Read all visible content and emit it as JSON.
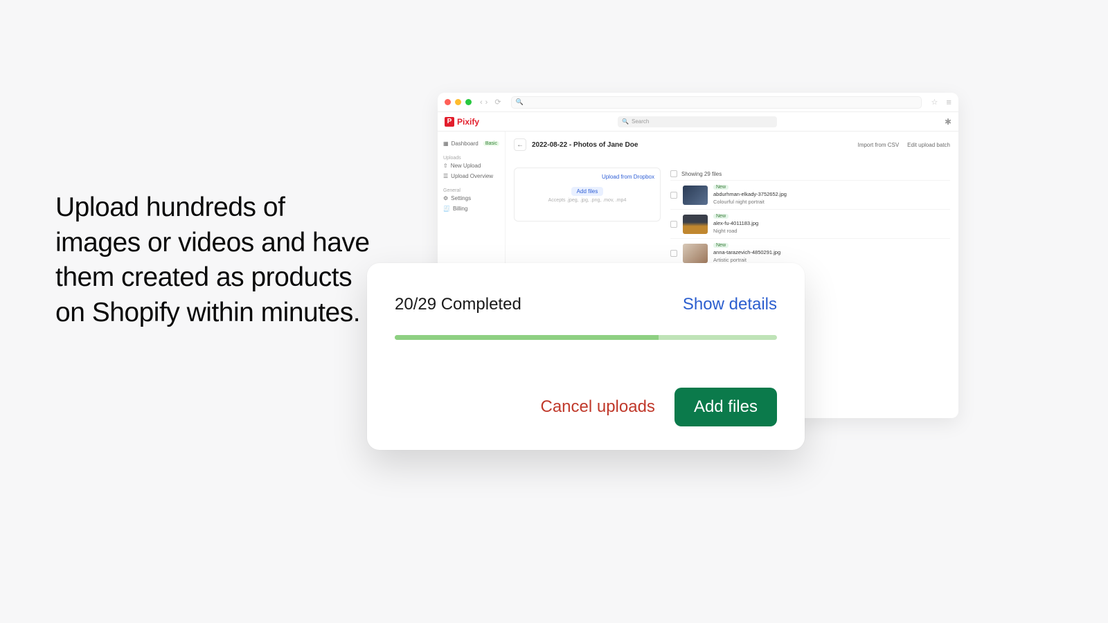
{
  "hero": {
    "title": "Upload hundreds of images or videos and have them created as products on Shopify within minutes."
  },
  "browser": {
    "urlbar_glyph": "🔍",
    "star_glyph": "☆",
    "menu_glyph": "≡"
  },
  "app": {
    "brand_letter": "P",
    "brand_name": "Pixify",
    "search_placeholder": "Search",
    "gear_glyph": "✱"
  },
  "sidebar": {
    "dashboard_label": "Dashboard",
    "dashboard_badge": "Basic",
    "section_uploads": "Uploads",
    "new_upload": "New Upload",
    "upload_overview": "Upload Overview",
    "section_general": "General",
    "settings": "Settings",
    "billing": "Billing"
  },
  "page": {
    "back_glyph": "←",
    "title": "2022-08-22 - Photos of Jane Doe",
    "import_csv": "Import from CSV",
    "edit_batch": "Edit upload batch"
  },
  "upload_card": {
    "dropbox_link": "Upload from Dropbox",
    "add_files": "Add files",
    "accepts": "Accepts .jpeg, .jpg, .png, .mov, .mp4"
  },
  "file_list": {
    "header": "Showing 29 files",
    "items": [
      {
        "badge": "New",
        "name": "abdurhman-elkady-3752652.jpg",
        "caption": "Colourful night portrait"
      },
      {
        "badge": "New",
        "name": "alex-fu-4011183.jpg",
        "caption": "Night road"
      },
      {
        "badge": "New",
        "name": "anna-tarazevich-4850291.jpg",
        "caption": "Artistic portrait"
      }
    ]
  },
  "modal": {
    "progress_label": "20/29 Completed",
    "show_details": "Show details",
    "cancel": "Cancel uploads",
    "add_files": "Add files",
    "progress_percent": 69
  }
}
